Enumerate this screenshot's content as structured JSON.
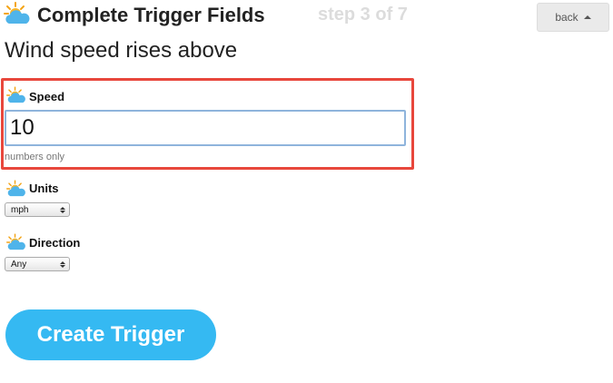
{
  "header": {
    "icon": "weather-cloud-sun-icon",
    "title": "Complete Trigger Fields",
    "step": "step 3 of 7",
    "back_label": "back"
  },
  "trigger": {
    "description": "Wind speed rises above"
  },
  "fields": {
    "speed": {
      "icon": "weather-cloud-sun-icon",
      "label": "Speed",
      "value": "10",
      "hint": "numbers only"
    },
    "units": {
      "icon": "weather-cloud-sun-icon",
      "label": "Units",
      "selected": "mph"
    },
    "direction": {
      "icon": "weather-cloud-sun-icon",
      "label": "Direction",
      "selected": "Any"
    }
  },
  "actions": {
    "create_label": "Create Trigger"
  },
  "colors": {
    "accent": "#35b9f2",
    "highlight": "#e8473c",
    "step_text": "#dcdcdc"
  }
}
